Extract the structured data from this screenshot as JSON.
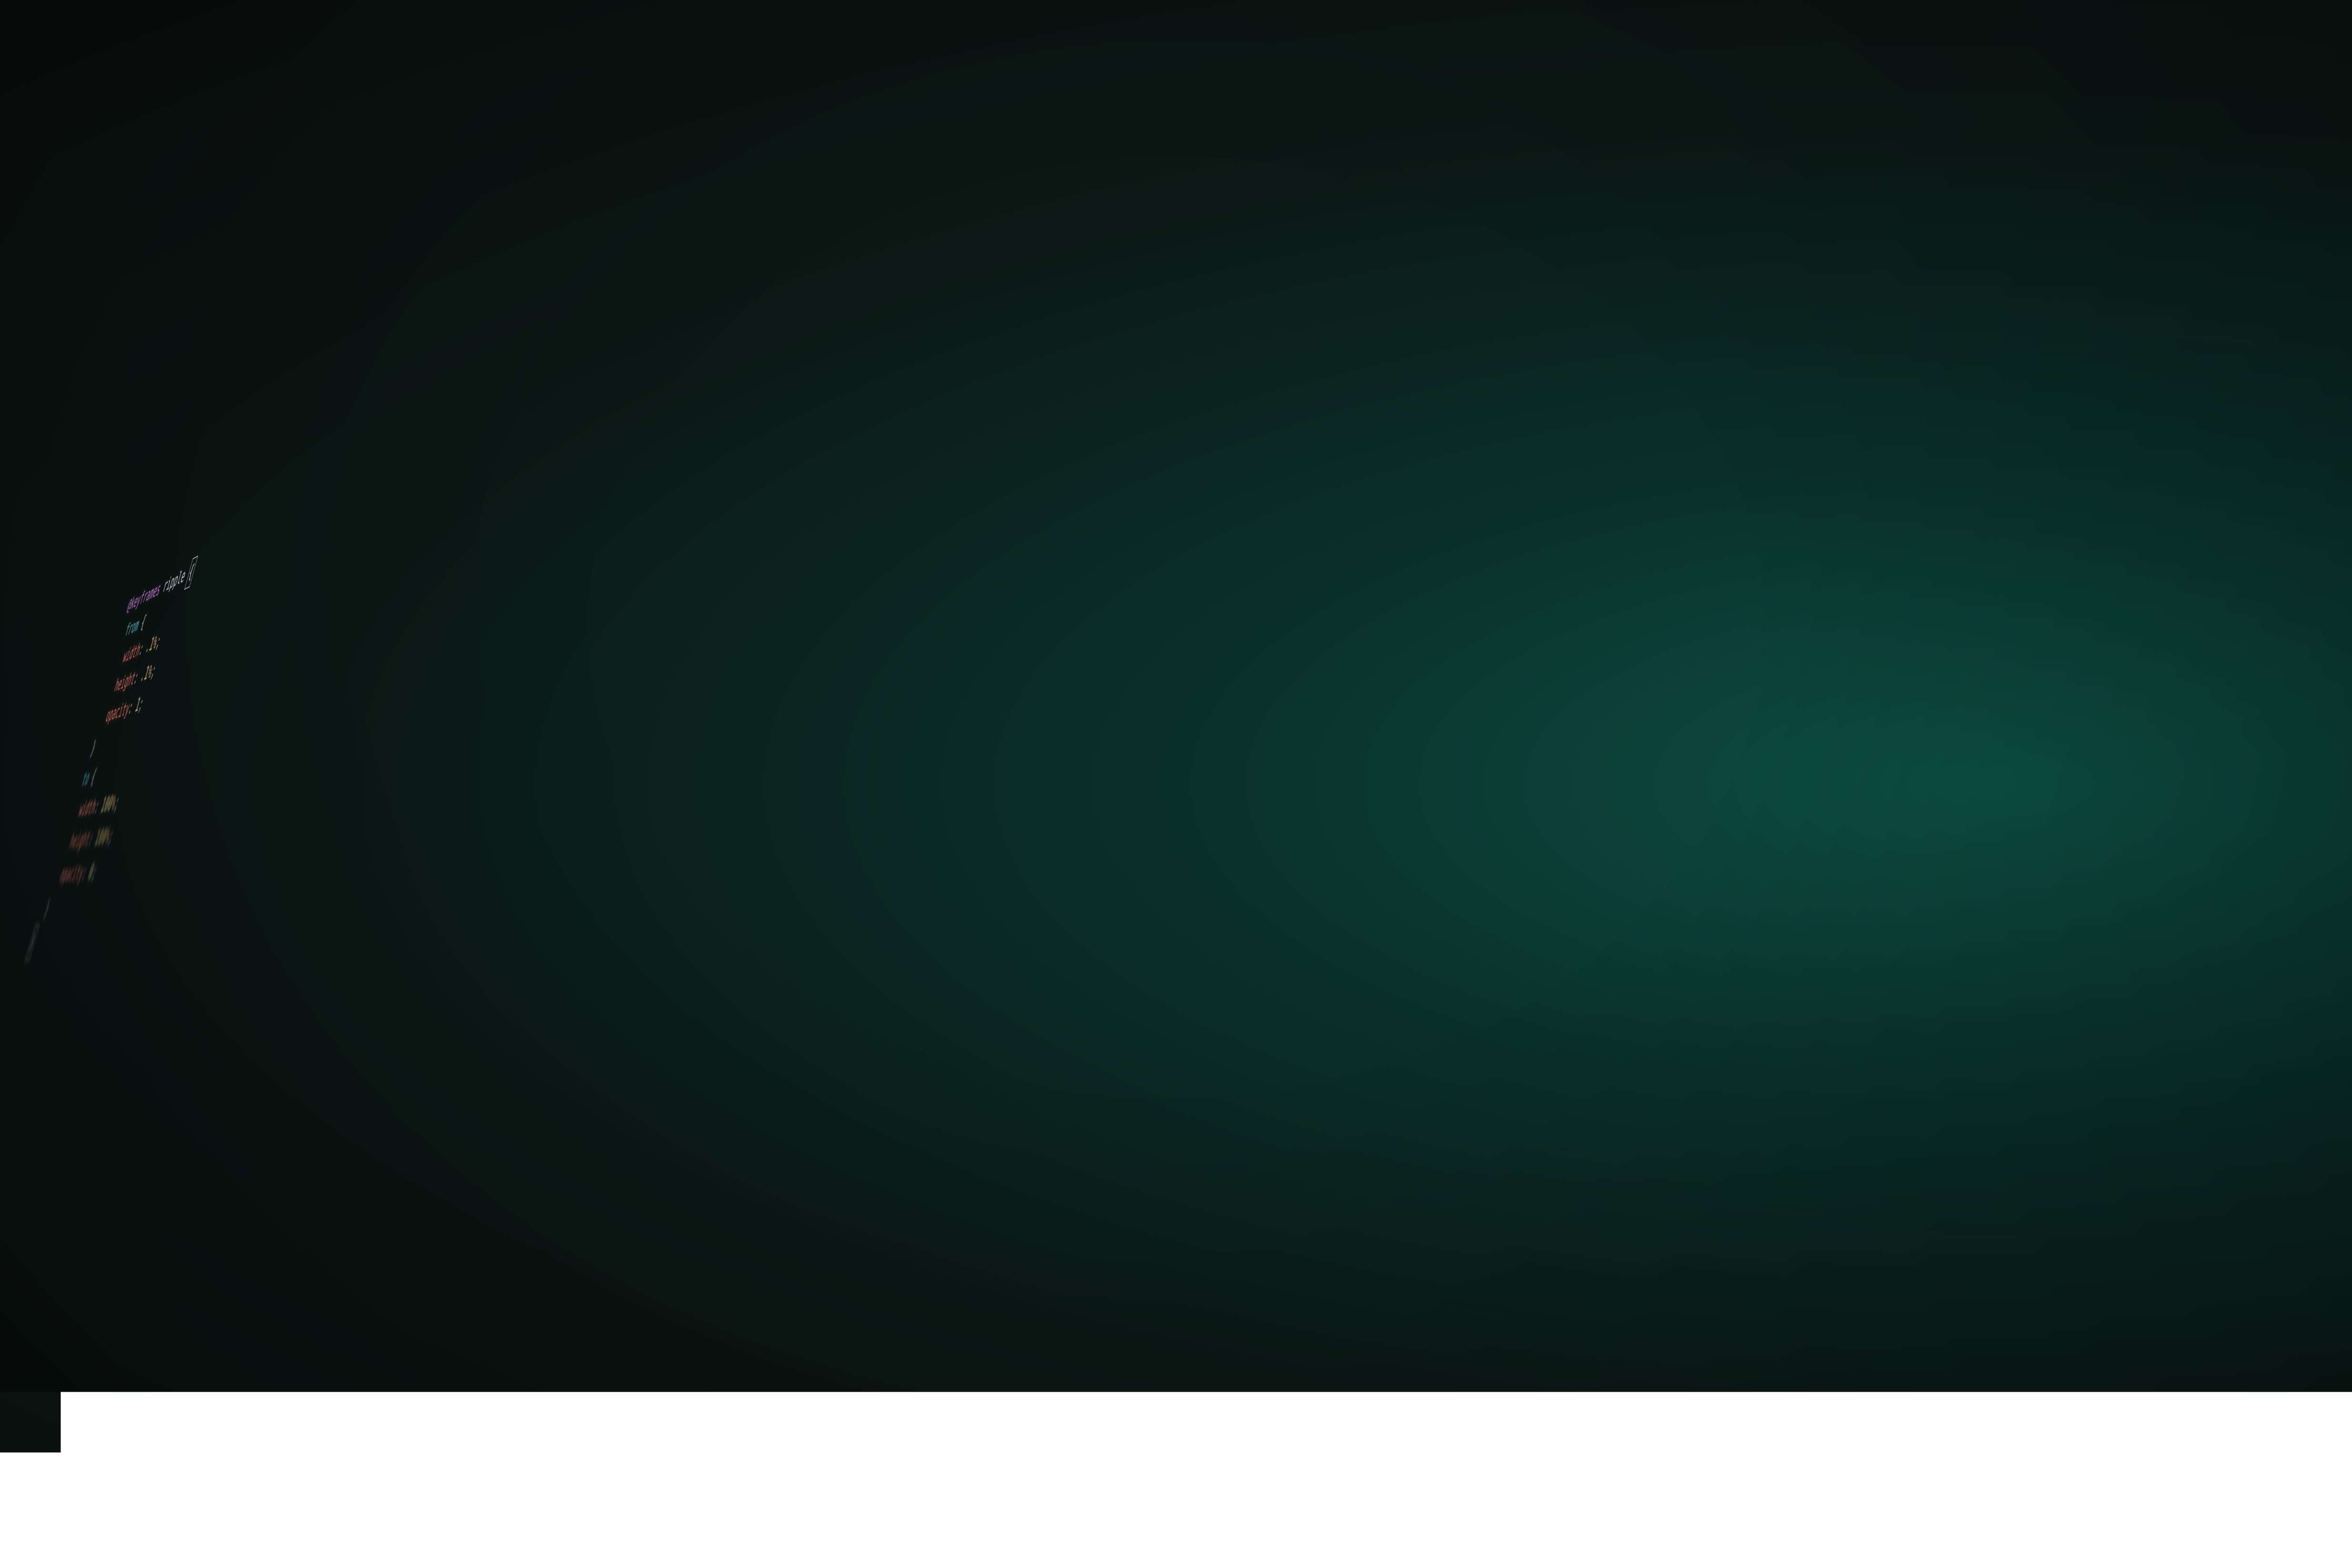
{
  "code": {
    "keyword": "@keyframes",
    "anim_name": "ripple",
    "open_brace": "{",
    "from": {
      "selector": "from",
      "brace_open": "{",
      "width_prop": "width",
      "width_val": ".1",
      "width_unit": "%",
      "height_prop": "height",
      "height_val": ".1",
      "height_unit": "%",
      "opacity_prop": "opacity",
      "opacity_val": "1",
      "brace_close": "}"
    },
    "to": {
      "selector": "to",
      "brace_open": "{",
      "width_prop": "width",
      "width_val": "100",
      "width_unit": "%",
      "height_prop": "height",
      "height_val": "100",
      "height_unit": "%",
      "opacity_prop": "opacity",
      "opacity_val": "0",
      "brace_close": "}"
    },
    "close_brace": "}"
  }
}
